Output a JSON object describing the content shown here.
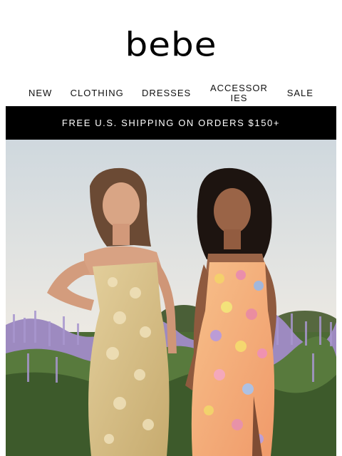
{
  "brand": {
    "logo_text": "bebe"
  },
  "nav": {
    "items": [
      {
        "label": "NEW"
      },
      {
        "label": "CLOTHING"
      },
      {
        "label": "DRESSES"
      },
      {
        "label": "ACCESSORIES"
      },
      {
        "label": "SALE"
      }
    ]
  },
  "promo": {
    "text": "FREE U.S. SHIPPING ON ORDERS $150+"
  },
  "hero": {
    "colors": {
      "sky": "#dfe3e6",
      "lavender": "#9a86b8",
      "foliage": "#3f5a2c",
      "dress_gold": "#d6c08b",
      "dress_floral": "#f3b07a"
    }
  }
}
